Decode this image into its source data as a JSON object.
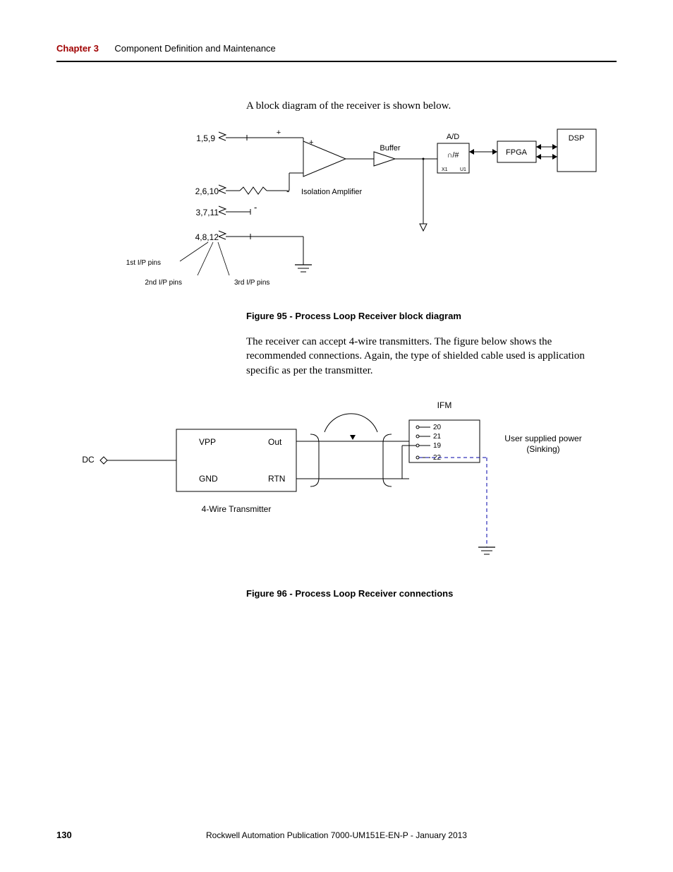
{
  "header": {
    "chapter_label": "Chapter 3",
    "chapter_title": "Component Definition and Maintenance"
  },
  "intro1": "A block diagram of the receiver is shown below.",
  "figure95": {
    "caption": "Figure 95 - Process Loop Receiver block diagram",
    "pins_row1": "1,5,9",
    "pins_row2": "2,6,10",
    "pins_row3": "3,7,11",
    "pins_row4": "4,8,12",
    "note_1st": "1st I/P pins",
    "note_2nd": "2nd I/P pins",
    "note_3rd": "3rd I/P pins",
    "plus1": "+",
    "plus2": "+",
    "minus1": "-",
    "minus2": "-",
    "buffer": "Buffer",
    "iso_amp": "Isolation Amplifier",
    "ad_box": "A/D",
    "ad_symbol": "∩/#",
    "ad_x1": "X1",
    "ad_u1": "U1",
    "fpga": "FPGA",
    "dsp": "DSP"
  },
  "intro2": "The receiver can accept 4-wire transmitters. The figure below shows the recommended connections. Again, the type of shielded cable used is application specific as per the transmitter.",
  "figure96": {
    "caption": "Figure 96 - Process Loop Receiver connections",
    "dc": "DC",
    "vpp": "VPP",
    "gnd": "GND",
    "out": "Out",
    "rtn": "RTN",
    "transmitter_label": "4-Wire Transmitter",
    "ifm": "IFM",
    "pin20": "20",
    "pin21": "21",
    "pin19": "19",
    "pin22": "22",
    "power_line1": "User supplied power",
    "power_line2": "(Sinking)"
  },
  "footer": {
    "pagenum": "130",
    "publine": "Rockwell Automation Publication 7000-UM151E-EN-P - January 2013"
  }
}
